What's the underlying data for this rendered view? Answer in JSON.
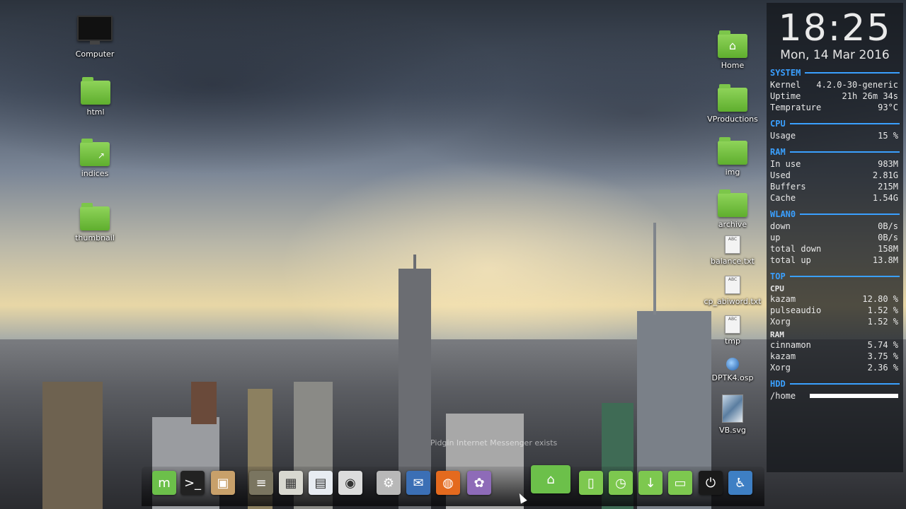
{
  "desktop": {
    "left_icons": [
      {
        "label": "Computer",
        "icon": "computer-icon"
      },
      {
        "label": "html",
        "icon": "folder-icon"
      },
      {
        "label": "indices",
        "icon": "folder-link-icon"
      },
      {
        "label": "thumbnail",
        "icon": "folder-icon"
      }
    ],
    "right_icons": [
      {
        "label": "Home",
        "icon": "home-folder-icon"
      },
      {
        "label": "VProductions",
        "icon": "folder-icon"
      },
      {
        "label": "img",
        "icon": "folder-icon"
      },
      {
        "label": "archive",
        "icon": "folder-icon"
      },
      {
        "label": "balance.txt",
        "icon": "text-file-icon"
      },
      {
        "label": "cp_abiword.txt",
        "icon": "text-file-icon"
      },
      {
        "label": "tmp",
        "icon": "text-file-icon"
      },
      {
        "label": "DPTK4.osp",
        "icon": "osp-file-icon"
      },
      {
        "label": "VB.svg",
        "icon": "image-file-icon"
      }
    ]
  },
  "conky": {
    "time": "18:25",
    "date": "Mon, 14 Mar 2016",
    "system": {
      "title": "SYSTEM",
      "rows": [
        {
          "k": "Kernel",
          "v": "4.2.0-30-generic"
        },
        {
          "k": "Uptime",
          "v": "21h 26m 34s"
        },
        {
          "k": "Temprature",
          "v": "93°C"
        }
      ]
    },
    "cpu": {
      "title": "CPU",
      "rows": [
        {
          "k": "Usage",
          "v": "15 %"
        }
      ]
    },
    "ram": {
      "title": "RAM",
      "rows": [
        {
          "k": "In use",
          "v": "983M"
        },
        {
          "k": "Used",
          "v": "2.81G"
        },
        {
          "k": "Buffers",
          "v": "215M"
        },
        {
          "k": "Cache",
          "v": "1.54G"
        }
      ]
    },
    "wlan": {
      "title": "WLAN0",
      "rows": [
        {
          "k": "down",
          "v": "0B/s"
        },
        {
          "k": "up",
          "v": "0B/s"
        },
        {
          "k": "total down",
          "v": "158M"
        },
        {
          "k": "total up",
          "v": "13.8M"
        }
      ]
    },
    "top": {
      "title": "TOP",
      "cpu_label": "CPU",
      "cpu_rows": [
        {
          "k": "kazam",
          "v": "12.80 %"
        },
        {
          "k": "pulseaudio",
          "v": "1.52 %"
        },
        {
          "k": "Xorg",
          "v": "1.52 %"
        }
      ],
      "ram_label": "RAM",
      "ram_rows": [
        {
          "k": "cinnamon",
          "v": "5.74 %"
        },
        {
          "k": "kazam",
          "v": "3.75 %"
        },
        {
          "k": "Xorg",
          "v": "2.36 %"
        }
      ]
    },
    "hdd": {
      "title": "HDD",
      "mount": "/home",
      "usage_fraction": 0.98
    }
  },
  "dock": {
    "tooltip": "Pidgin Internet Messenger exists",
    "items": [
      {
        "icon": "mint-menu-icon",
        "color": "#6cc04a",
        "glyph": "m"
      },
      {
        "icon": "terminal-icon",
        "color": "#222222",
        "glyph": ">_"
      },
      {
        "icon": "archive-manager-icon",
        "color": "#c8a06a",
        "glyph": "▣"
      },
      {
        "icon": "scanner-icon",
        "color": "#7a7560",
        "glyph": "≡"
      },
      {
        "icon": "calculator-icon",
        "color": "#d8d8d0",
        "glyph": "▦"
      },
      {
        "icon": "document-viewer-icon",
        "color": "#e8ecf2",
        "glyph": "▤"
      },
      {
        "icon": "cd-burner-icon",
        "color": "#dcdcdc",
        "glyph": "◉"
      },
      {
        "icon": "system-tools-icon",
        "color": "#b8b8b8",
        "glyph": "⚙"
      },
      {
        "icon": "thunderbird-icon",
        "color": "#3b6fb5",
        "glyph": "✉"
      },
      {
        "icon": "firefox-icon",
        "color": "#e46a1e",
        "glyph": "◍"
      },
      {
        "icon": "pidgin-icon",
        "color": "#8e6bb8",
        "glyph": "✿"
      },
      {
        "icon": "home-folder-icon",
        "color": "#6cc04a",
        "glyph": "⌂"
      },
      {
        "icon": "documents-folder-icon",
        "color": "#7dc84f",
        "glyph": "▯"
      },
      {
        "icon": "recent-folder-icon",
        "color": "#7dc84f",
        "glyph": "◷"
      },
      {
        "icon": "downloads-folder-icon",
        "color": "#7dc84f",
        "glyph": "↓"
      },
      {
        "icon": "desktop-folder-icon",
        "color": "#7dc84f",
        "glyph": "▭"
      },
      {
        "icon": "shutdown-icon",
        "color": "#1a1a1a",
        "glyph": "⏻"
      },
      {
        "icon": "accessibility-icon",
        "color": "#3e7fc4",
        "glyph": "♿"
      }
    ]
  }
}
